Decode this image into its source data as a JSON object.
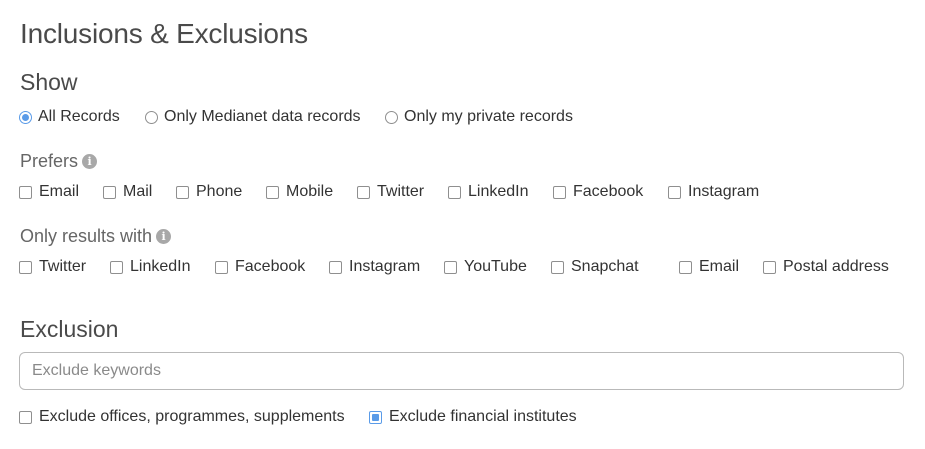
{
  "page_title": "Inclusions & Exclusions",
  "show": {
    "heading": "Show",
    "options": [
      {
        "label": "All Records",
        "checked": true
      },
      {
        "label": "Only Medianet data records",
        "checked": false
      },
      {
        "label": "Only my private records",
        "checked": false
      }
    ]
  },
  "prefers": {
    "heading": "Prefers",
    "icon": "info-icon",
    "options": [
      {
        "label": "Email",
        "checked": false
      },
      {
        "label": "Mail",
        "checked": false
      },
      {
        "label": "Phone",
        "checked": false
      },
      {
        "label": "Mobile",
        "checked": false
      },
      {
        "label": "Twitter",
        "checked": false
      },
      {
        "label": "LinkedIn",
        "checked": false
      },
      {
        "label": "Facebook",
        "checked": false
      },
      {
        "label": "Instagram",
        "checked": false
      }
    ]
  },
  "only_results": {
    "heading": "Only results with",
    "icon": "info-icon",
    "options": [
      {
        "label": "Twitter",
        "checked": false
      },
      {
        "label": "LinkedIn",
        "checked": false
      },
      {
        "label": "Facebook",
        "checked": false
      },
      {
        "label": "Instagram",
        "checked": false
      },
      {
        "label": "YouTube",
        "checked": false
      },
      {
        "label": "Snapchat",
        "checked": false
      },
      {
        "label": "Email",
        "checked": false
      },
      {
        "label": "Postal address",
        "checked": false
      }
    ]
  },
  "exclusion": {
    "heading": "Exclusion",
    "keywords_placeholder": "Exclude keywords",
    "keywords_value": "",
    "options": [
      {
        "label": "Exclude offices, programmes, supplements",
        "checked": false
      },
      {
        "label": "Exclude financial institutes",
        "checked": true
      }
    ]
  },
  "colors": {
    "accent": "#5a9be8",
    "border": "#8f8f8f",
    "heading": "#4a4a4a"
  }
}
